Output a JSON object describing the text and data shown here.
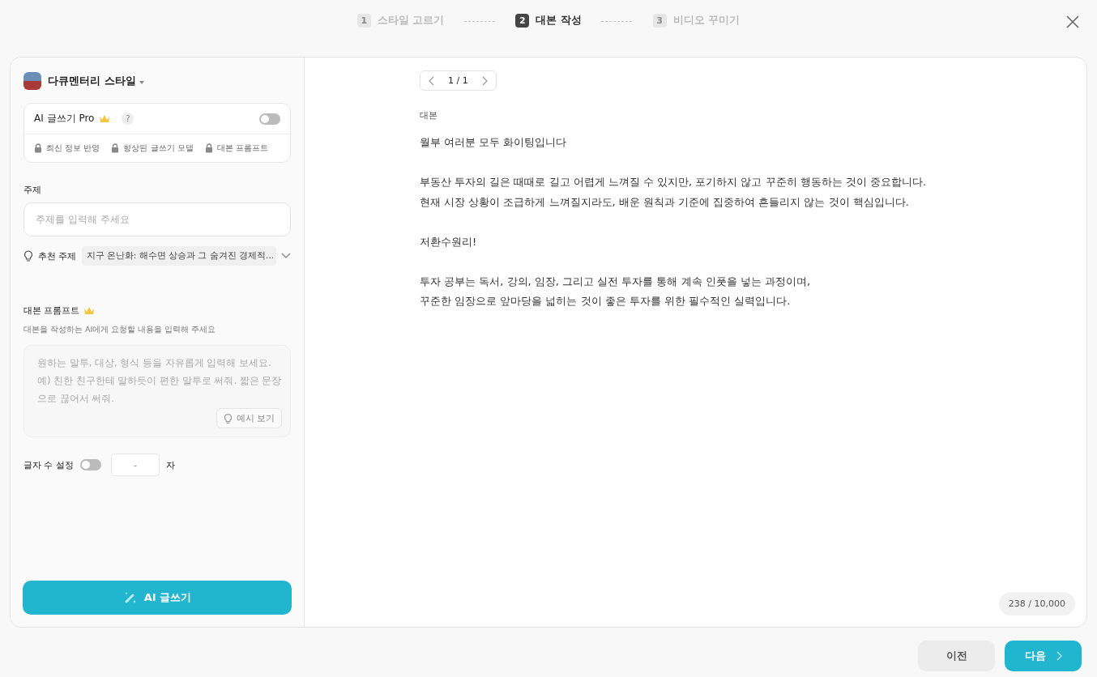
{
  "steps": [
    {
      "number": "1",
      "label": "스타일 고르기",
      "selected": false
    },
    {
      "number": "2",
      "label": "대본 작성",
      "selected": true
    },
    {
      "number": "3",
      "label": "비디오 꾸미기",
      "selected": false
    }
  ],
  "step_separator": "--------",
  "style_selector": {
    "label": "다큐멘터리 스타일"
  },
  "pro_box": {
    "title": "AI 글쓰기 Pro",
    "help": "?",
    "on": false,
    "features": [
      "최신 정보 반영",
      "향상된 글쓰기 모델",
      "대본 프롬프트"
    ]
  },
  "topic": {
    "label": "주제",
    "placeholder": "주제를 입력해 주세요"
  },
  "recommended_topic": {
    "label": "추천 주제",
    "value": "지구 온난화: 해수면 상승과 그 숨겨진 경제적..."
  },
  "script_prompt": {
    "label": "대본 프롬프트",
    "description": "대본을 작성하는 AI에게 요청할 내용을 입력해 주세요",
    "placeholder": "원하는 말투, 대상, 형식 등을 자유롭게 입력해 보세요.\n예) 친한 친구한테 말하듯이 편한 말투로 써줘. 짧은 문장으로 끊어서 써줘.",
    "example_button": "예시 보기"
  },
  "char_limit": {
    "label": "글자 수 설정",
    "on": false,
    "value": "-",
    "unit": "자"
  },
  "generate_button": "AI 글쓰기",
  "pager": {
    "text": "1 / 1"
  },
  "script": {
    "label": "대본",
    "paragraphs": [
      [
        "월부 여러분 모두 화이팅입니다"
      ],
      [
        "부동산 투자의 길은 때때로 길고 어렵게 느껴질 수 있지만, 포기하지 않고 꾸준히 행동하는 것이 중요합니다.",
        "현재 시장 상황이 조급하게 느껴질지라도, 배운 원칙과 기준에 집중하여 흔들리지 않는 것이 핵심입니다."
      ],
      [
        "저환수원리!"
      ],
      [
        "투자 공부는 독서, 강의, 임장, 그리고 실전 투자를 통해 계속 인풋을 넣는 과정이며,",
        "꾸준한 임장으로 앞마당을 넓히는 것이 좋은 투자를 위한 필수적인 실력입니다."
      ]
    ],
    "count": "238 / 10,000"
  },
  "footer": {
    "prev": "이전",
    "next": "다음"
  }
}
